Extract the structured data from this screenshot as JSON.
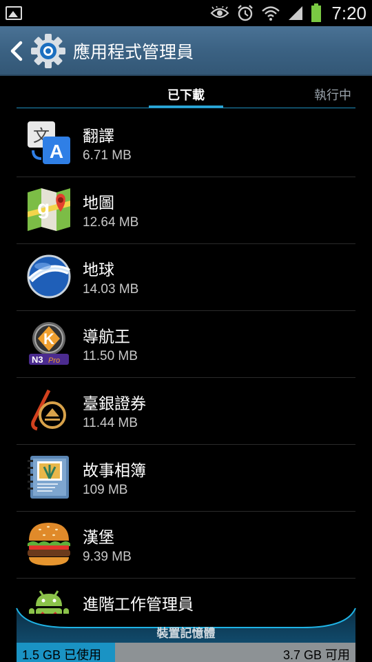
{
  "status_bar": {
    "time": "7:20",
    "icons": [
      "gallery-icon",
      "eye-icon",
      "alarm-icon",
      "wifi-icon",
      "signal-icon",
      "battery-icon"
    ]
  },
  "header": {
    "title": "應用程式管理員",
    "back_icon": "back-arrow-icon",
    "app_icon": "settings-gear-icon"
  },
  "tabs": [
    {
      "label": "已下載",
      "selected": true
    },
    {
      "label": "執行中",
      "selected": false
    }
  ],
  "apps": [
    {
      "name": "翻譯",
      "size": "6.71 MB",
      "icon": "translate-icon"
    },
    {
      "name": "地圖",
      "size": "12.64 MB",
      "icon": "maps-icon"
    },
    {
      "name": "地球",
      "size": "14.03 MB",
      "icon": "earth-icon"
    },
    {
      "name": "導航王",
      "size": "11.50 MB",
      "icon": "navking-icon"
    },
    {
      "name": "臺銀證券",
      "size": "11.44 MB",
      "icon": "bank-securities-icon"
    },
    {
      "name": "故事相簿",
      "size": "109 MB",
      "icon": "story-album-icon"
    },
    {
      "name": "漢堡",
      "size": "9.39 MB",
      "icon": "burger-icon"
    },
    {
      "name": "進階工作管理員",
      "size": "",
      "icon": "android-task-icon"
    }
  ],
  "storage": {
    "label": "裝置記憶體",
    "used": "1.5 GB 已使用",
    "free": "3.7 GB 可用",
    "used_fraction": 0.29
  },
  "colors": {
    "accent": "#2aa6d7",
    "header": "#3b6283",
    "storage_used": "#1a93c4"
  }
}
